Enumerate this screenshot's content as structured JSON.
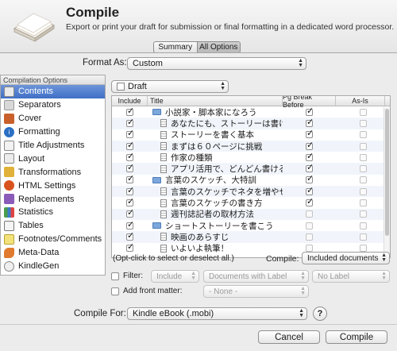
{
  "header": {
    "title": "Compile",
    "subtitle": "Export or print your draft for submission or final formatting in a dedicated word processor."
  },
  "tabs": {
    "summary": "Summary",
    "all_options": "All Options",
    "selected": "All Options"
  },
  "format": {
    "label": "Format As:",
    "value": "Custom"
  },
  "sidebar": {
    "header": "Compilation Options",
    "items": [
      {
        "label": "Contents",
        "icon": "contents-icon",
        "selected": true
      },
      {
        "label": "Separators",
        "icon": "separators-icon"
      },
      {
        "label": "Cover",
        "icon": "cover-icon"
      },
      {
        "label": "Formatting",
        "icon": "formatting-icon"
      },
      {
        "label": "Title Adjustments",
        "icon": "title-adjustments-icon"
      },
      {
        "label": "Layout",
        "icon": "layout-icon"
      },
      {
        "label": "Transformations",
        "icon": "transformations-icon"
      },
      {
        "label": "HTML Settings",
        "icon": "html-settings-icon"
      },
      {
        "label": "Replacements",
        "icon": "replacements-icon"
      },
      {
        "label": "Statistics",
        "icon": "statistics-icon"
      },
      {
        "label": "Tables",
        "icon": "tables-icon"
      },
      {
        "label": "Footnotes/Comments",
        "icon": "footnotes-icon"
      },
      {
        "label": "Meta-Data",
        "icon": "meta-data-icon"
      },
      {
        "label": "KindleGen",
        "icon": "kindlegen-icon"
      }
    ]
  },
  "contents": {
    "folder_selector": "Draft",
    "columns": {
      "include": "Include",
      "title": "Title",
      "pg_break": "Pg Break Before",
      "as_is": "As-Is"
    },
    "rows": [
      {
        "title": "小説家・脚本家になろう",
        "type": "folder",
        "level": 0,
        "include": true,
        "pg_break": true,
        "as_is": false
      },
      {
        "title": "あなたにも、ストーリーは書け…",
        "type": "doc",
        "level": 1,
        "include": true,
        "pg_break": true,
        "as_is": false
      },
      {
        "title": "ストーリーを書く基本",
        "type": "doc",
        "level": 1,
        "include": true,
        "pg_break": true,
        "as_is": false
      },
      {
        "title": "まずは６０ページに挑戦",
        "type": "doc",
        "level": 1,
        "include": true,
        "pg_break": true,
        "as_is": false
      },
      {
        "title": "作家の種類",
        "type": "doc",
        "level": 1,
        "include": true,
        "pg_break": true,
        "as_is": false
      },
      {
        "title": "アプリ活用で、どんどん書ける！",
        "type": "doc",
        "level": 1,
        "include": true,
        "pg_break": true,
        "as_is": false
      },
      {
        "title": "言葉のスケッチ、大特訓",
        "type": "folder",
        "level": 0,
        "include": true,
        "pg_break": true,
        "as_is": false
      },
      {
        "title": "言葉のスケッチでネタを増やせ！",
        "type": "doc",
        "level": 1,
        "include": true,
        "pg_break": true,
        "as_is": false
      },
      {
        "title": "言葉のスケッチの書き方",
        "type": "doc",
        "level": 1,
        "include": true,
        "pg_break": true,
        "as_is": false
      },
      {
        "title": "週刊誌記者の取材方法",
        "type": "doc",
        "level": 1,
        "include": true,
        "pg_break": false,
        "as_is": false
      },
      {
        "title": "ショートストーリーを書こう",
        "type": "folder",
        "level": 0,
        "include": true,
        "pg_break": false,
        "as_is": false
      },
      {
        "title": "映画のあらすじ",
        "type": "doc",
        "level": 1,
        "include": true,
        "pg_break": false,
        "as_is": false
      },
      {
        "title": "いよいよ執筆！",
        "type": "doc",
        "level": 1,
        "include": true,
        "pg_break": false,
        "as_is": false
      }
    ],
    "hint": "(Opt-click to select or deselect all.)",
    "compile_label": "Compile:",
    "compile_value": "Included documents"
  },
  "filter": {
    "label": "Filter:",
    "mode": "Include",
    "criteria": "Documents with Label",
    "value": "No Label"
  },
  "front_matter": {
    "label": "Add front matter:",
    "value": "- None -"
  },
  "compile_for": {
    "label": "Compile For:",
    "value": "Kindle eBook (.mobi)"
  },
  "buttons": {
    "help": "?",
    "cancel": "Cancel",
    "compile": "Compile"
  }
}
